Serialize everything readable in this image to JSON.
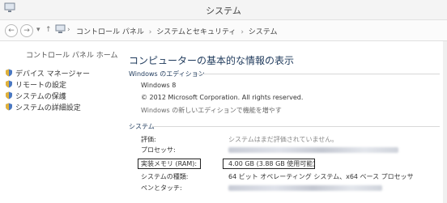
{
  "window": {
    "title": "システム",
    "icon": "computer-icon"
  },
  "address": {
    "nav": {
      "back": "back-icon",
      "forward": "forward-icon",
      "recent": "chevron-down-icon",
      "up": "up-arrow-icon"
    },
    "breadcrumbs": [
      "コントロール パネル",
      "システムとセキュリティ",
      "システム"
    ],
    "separator": "›"
  },
  "sidebar": {
    "home": "コントロール パネル ホーム",
    "items": [
      {
        "label": "デバイス マネージャー",
        "icon": "shield-icon"
      },
      {
        "label": "リモートの設定",
        "icon": "shield-icon"
      },
      {
        "label": "システムの保護",
        "icon": "shield-icon"
      },
      {
        "label": "システムの詳細設定",
        "icon": "shield-icon"
      }
    ]
  },
  "main": {
    "heading": "コンピューターの基本的な情報の表示",
    "edition": {
      "section": "Windows のエディション",
      "name": "Windows 8",
      "copyright": "© 2012 Microsoft Corporation. All rights reserved.",
      "upgrade_link": "Windows の新しいエディションで機能を増やす"
    },
    "system": {
      "section": "システム",
      "rating_label": "評価:",
      "rating_value": "システムはまだ評価されていません。",
      "processor_label": "プロセッサ:",
      "ram_label": "実装メモリ (RAM):",
      "ram_value": "4.00 GB (3.88 GB 使用可能)",
      "type_label": "システムの種類:",
      "type_value": "64 ビット オペレーティング システム、x64 ベース プロセッサ",
      "pen_label": "ペンとタッチ:"
    }
  }
}
